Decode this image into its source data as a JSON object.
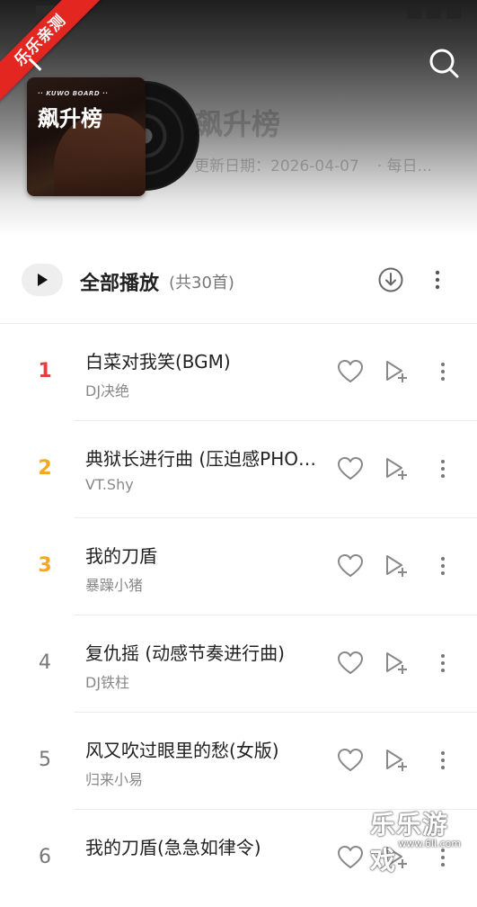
{
  "ribbon": {
    "text": "乐乐亲测"
  },
  "header": {
    "cover_board_label": "·· KUWO BOARD ··",
    "cover_title": "飙升榜",
    "title": "飙升榜",
    "update_label": "更新日期：2026-04-07",
    "update_extra": "· 每日..."
  },
  "icons": {
    "search": "search-icon",
    "download": "download-icon",
    "more": "more-vertical-icon",
    "heart": "heart-icon",
    "add_to_playlist": "add-to-playlist-icon",
    "play": "play-icon"
  },
  "play_bar": {
    "label": "全部播放",
    "count": "(共30首)"
  },
  "songs": [
    {
      "rank": "1",
      "title": "白菜对我笑(BGM)",
      "artist": "DJ决绝"
    },
    {
      "rank": "2",
      "title": "典狱长进行曲 (压迫感PHONK)",
      "artist": "VT.Shy"
    },
    {
      "rank": "3",
      "title": "我的刀盾",
      "artist": "暴躁小猪"
    },
    {
      "rank": "4",
      "title": "复仇摇 (动感节奏进行曲)",
      "artist": "DJ铁柱"
    },
    {
      "rank": "5",
      "title": "风又吹过眼里的愁(女版)",
      "artist": "归来小易"
    },
    {
      "rank": "6",
      "title": "我的刀盾(急急如律令)",
      "artist": ""
    }
  ],
  "watermark": {
    "main": "乐乐游戏",
    "url": "www.6ll.com"
  },
  "colors": {
    "rank_top1": "#e83b3b",
    "rank_top2_3": "#f5a623",
    "ribbon": "#e3261f"
  }
}
